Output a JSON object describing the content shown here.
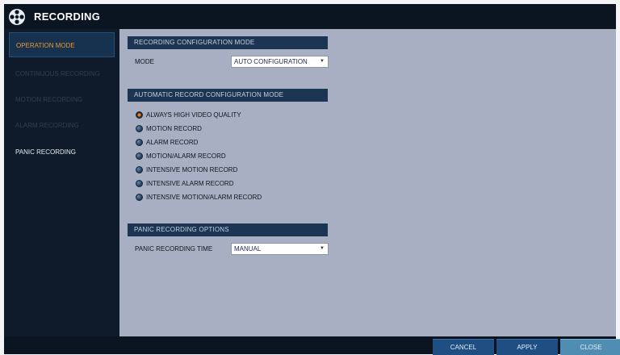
{
  "window": {
    "title": "RECORDING",
    "icon": "film-reel-icon"
  },
  "sidebar": {
    "items": [
      {
        "label": "OPERATION MODE",
        "state": "active"
      },
      {
        "label": "CONTINUOUS RECORDING",
        "state": "disabled"
      },
      {
        "label": "MOTION RECORDING",
        "state": "disabled"
      },
      {
        "label": "ALARM RECORDING",
        "state": "disabled"
      },
      {
        "label": "PANIC RECORDING",
        "state": "normal"
      }
    ]
  },
  "sections": {
    "config_mode": {
      "header": "RECORDING CONFIGURATION MODE",
      "mode_label": "MODE",
      "mode_value": "AUTO CONFIGURATION"
    },
    "auto_record": {
      "header": "AUTOMATIC RECORD CONFIGURATION MODE",
      "options": [
        "ALWAYS HIGH VIDEO QUALITY",
        "MOTION RECORD",
        "ALARM RECORD",
        "MOTION/ALARM RECORD",
        "INTENSIVE MOTION RECORD",
        "INTENSIVE ALARM RECORD",
        "INTENSIVE MOTION/ALARM RECORD"
      ],
      "selected": "ALWAYS HIGH VIDEO QUALITY"
    },
    "panic": {
      "header": "PANIC RECORDING OPTIONS",
      "time_label": "PANIC RECORDING TIME",
      "time_value": "MANUAL"
    }
  },
  "buttons": {
    "cancel": "CANCEL",
    "apply": "APPLY",
    "close": "CLOSE"
  },
  "colors": {
    "accent": "#f0952d",
    "content_bg": "#a9afc3",
    "header_bg": "#1c3552",
    "window_bg": "#0f1b2b"
  }
}
